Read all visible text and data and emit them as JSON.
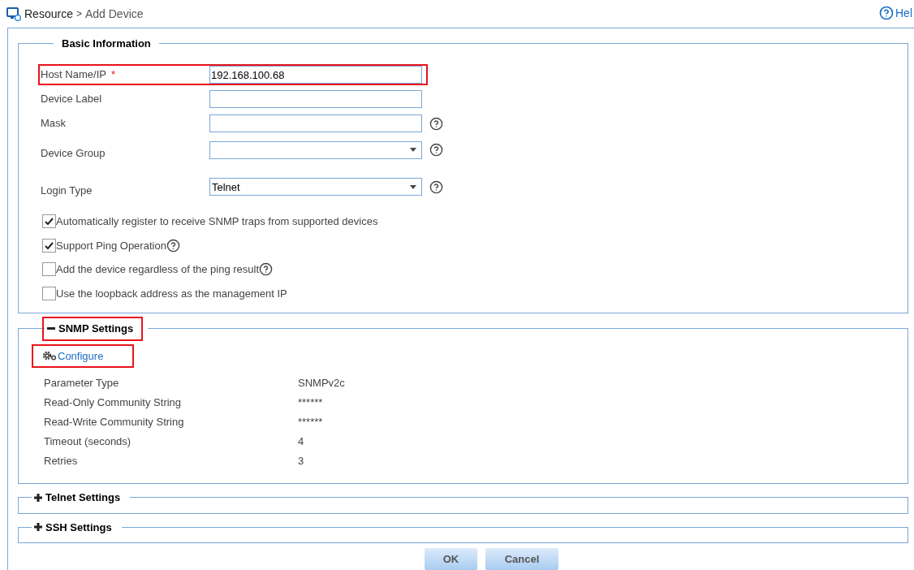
{
  "breadcrumb": {
    "root": "Resource",
    "separator": ">",
    "current": "Add Device"
  },
  "help_link": "Hel",
  "basic": {
    "title": "Basic Information",
    "fields": [
      {
        "kind": "text",
        "label": "Host Name/IP",
        "required_mark": "*",
        "value": "192.168.100.68",
        "highlighted": true,
        "help": false
      },
      {
        "kind": "text",
        "label": "Device Label",
        "highlighted": false,
        "help": false
      },
      {
        "kind": "text",
        "label": "Mask",
        "highlighted": false,
        "help": true
      },
      {
        "kind": "select",
        "label": "Device Group",
        "highlighted": false,
        "help": true
      },
      {
        "kind": "select",
        "label": "Login Type",
        "value": "Telnet",
        "highlighted": false,
        "help": true
      }
    ],
    "options": [
      {
        "label": "Automatically register to receive SNMP traps from supported devices",
        "checked": true,
        "help": false
      },
      {
        "label": "Support Ping Operation",
        "checked": true,
        "help": true
      },
      {
        "label": "Add the device regardless of the ping result",
        "checked": false,
        "help": true
      },
      {
        "label": "Use the loopback address as the management IP",
        "checked": false,
        "help": false
      }
    ]
  },
  "sections": [
    {
      "title": "SNMP Settings",
      "expanded": true,
      "highlighted": true,
      "configure": {
        "label": "Configure",
        "highlighted": true
      },
      "params": [
        {
          "name": "Parameter Type",
          "value": "SNMPv2c"
        },
        {
          "name": "Read-Only Community String",
          "value": "******"
        },
        {
          "name": "Read-Write Community String",
          "value": "******"
        },
        {
          "name": "Timeout (seconds)",
          "value": "4"
        },
        {
          "name": "Retries",
          "value": "3"
        }
      ]
    },
    {
      "title": "Telnet Settings",
      "expanded": false,
      "highlighted": false
    },
    {
      "title": "SSH Settings",
      "expanded": false,
      "highlighted": false
    }
  ],
  "buttons": [
    "OK",
    "Cancel"
  ]
}
